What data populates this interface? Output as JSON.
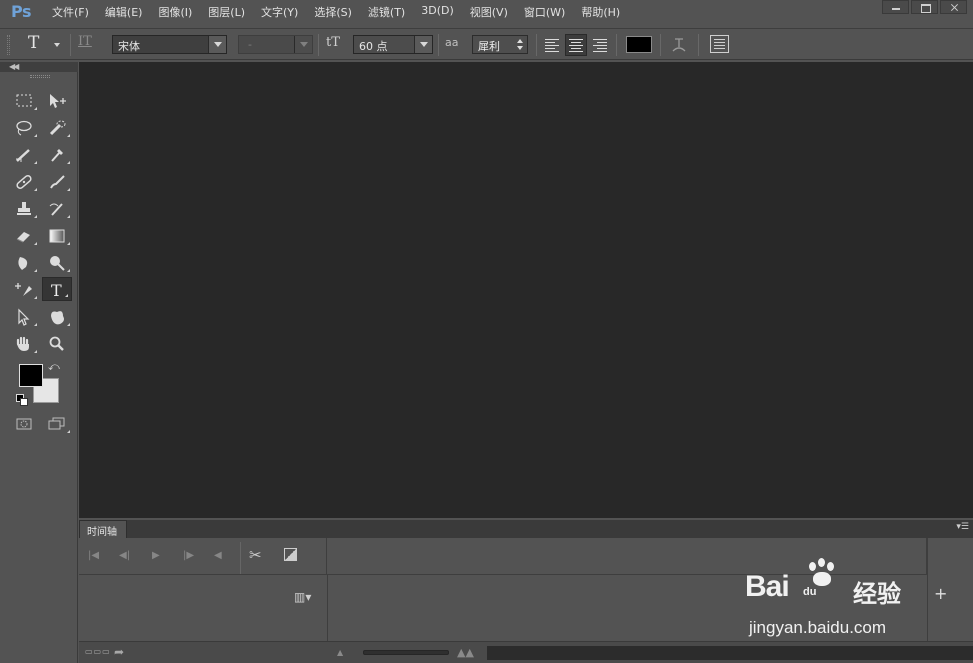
{
  "app": {
    "logo": "Ps"
  },
  "menu": [
    "文件(F)",
    "编辑(E)",
    "图像(I)",
    "图层(L)",
    "文字(Y)",
    "选择(S)",
    "滤镜(T)",
    "3D(D)",
    "视图(V)",
    "窗口(W)",
    "帮助(H)"
  ],
  "options": {
    "tool_glyph": "T",
    "orient_glyph": "IT",
    "font_family": "宋体",
    "font_style": "-",
    "size_glyph": "tT",
    "font_size": "60 点",
    "aa_glyph": "aa",
    "antialias": "犀利",
    "text_color": "#000000"
  },
  "toolbox": {
    "foreground": "#000000",
    "background": "#e6e6e6",
    "active_tool": "type-tool"
  },
  "timeline": {
    "tab_label": "时间轴"
  },
  "watermark": {
    "brand": "Bai",
    "brand_suffix": "du",
    "cn": "经验",
    "url": "jingyan.baidu.com"
  }
}
